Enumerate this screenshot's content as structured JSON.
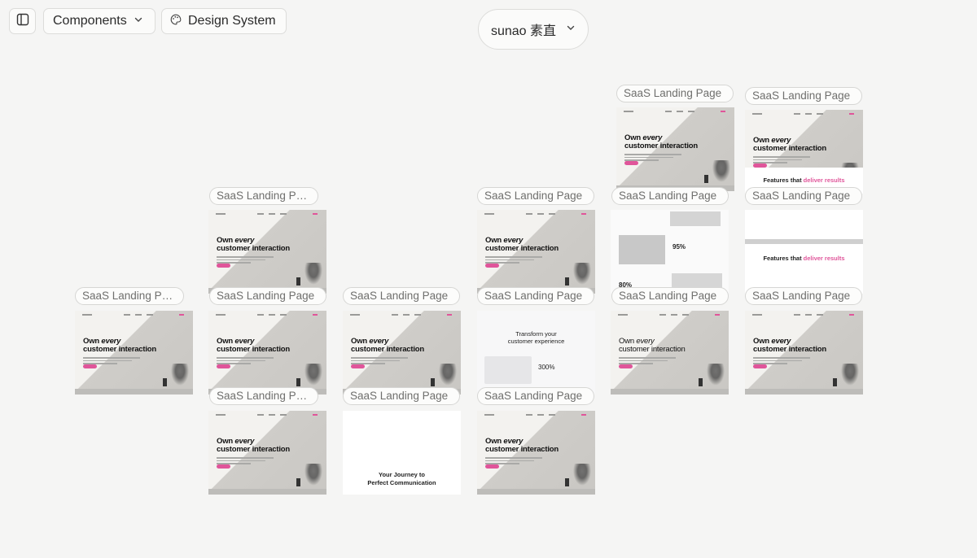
{
  "toolbar": {
    "components_label": "Components",
    "design_system_label": "Design System",
    "sidebar_toggle_icon": "sidebar-panel-icon",
    "components_chevron_icon": "chevron-down-icon",
    "design_system_icon": "palette-icon"
  },
  "workspace": {
    "name": "sunao 素直",
    "chevron_icon": "chevron-down-icon"
  },
  "cards": {
    "c1": "SaaS Landing Page",
    "c2": "SaaS Landing Page",
    "c3": "SaaS Landing Page",
    "c4": "SaaS Landing Page",
    "c5": "SaaS Landing Page",
    "c6": "SaaS Landing Page",
    "c7": "SaaS Landing Page",
    "c8": "SaaS Landing Page",
    "c9": "SaaS Landing Page",
    "c10": "SaaS Landing Page",
    "c11": "SaaS Landing Page",
    "c12": "SaaS Landing Page",
    "c13": "SaaS Landing Page",
    "c14": "SaaS Landing Page",
    "c15": "SaaS Landing Page",
    "c16": "SaaS Landing Page"
  },
  "thumb": {
    "hero_line1": "Own ",
    "hero_em": "every",
    "hero_line2": "customer interaction",
    "features_prefix": "Features that ",
    "features_accent": "deliver results",
    "transform_line1": "Transform your",
    "transform_line2": "customer experience",
    "stat_300": "300%",
    "stat_95": "95%",
    "stat_80": "80%",
    "journey_line1": "Your Journey to",
    "journey_line2": "Perfect Communication"
  },
  "colors": {
    "background": "#f5f5f4",
    "accent_pink": "#e0559a"
  }
}
